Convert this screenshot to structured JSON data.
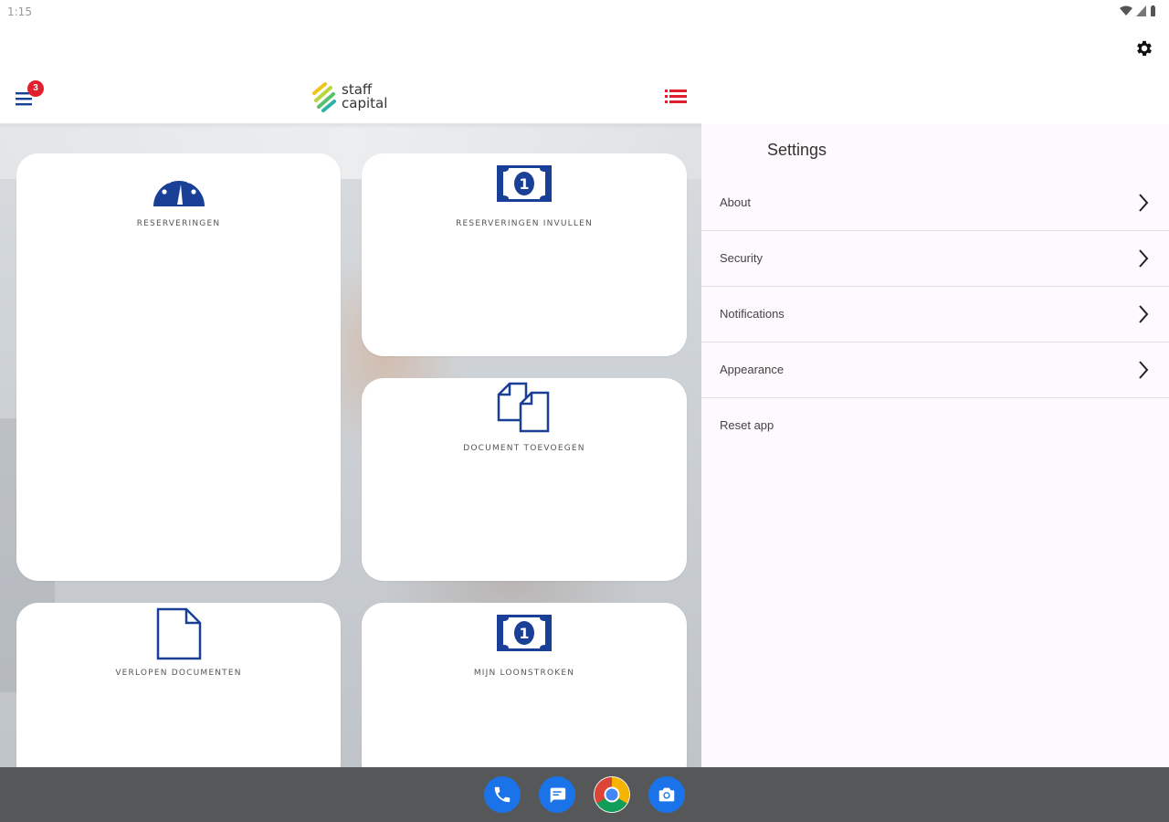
{
  "status_bar": {
    "time": "1:15"
  },
  "header": {
    "menu_badge_count": "3",
    "logo_line1": "staff",
    "logo_line2": "capital"
  },
  "tiles": [
    {
      "label": "RESERVERINGEN"
    },
    {
      "label": "RESERVERINGEN INVULLEN"
    },
    {
      "label": "DOCUMENT TOEVOEGEN"
    },
    {
      "label": "VERLOPEN DOCUMENTEN"
    },
    {
      "label": "MIJN LOONSTROKEN"
    }
  ],
  "settings": {
    "title": "Settings",
    "items": [
      {
        "label": "About"
      },
      {
        "label": "Security"
      },
      {
        "label": "Notifications"
      },
      {
        "label": "Appearance"
      },
      {
        "label": "Reset app"
      }
    ]
  },
  "colors": {
    "accent_blue": "#1a3f96",
    "badge_red": "#e0202e",
    "list_icon_red": "#e0202e",
    "settings_bg": "#fdf9fd",
    "nav_bar": "#555759"
  },
  "dock": [
    "phone-icon",
    "messages-icon",
    "chrome-icon",
    "camera-icon"
  ]
}
